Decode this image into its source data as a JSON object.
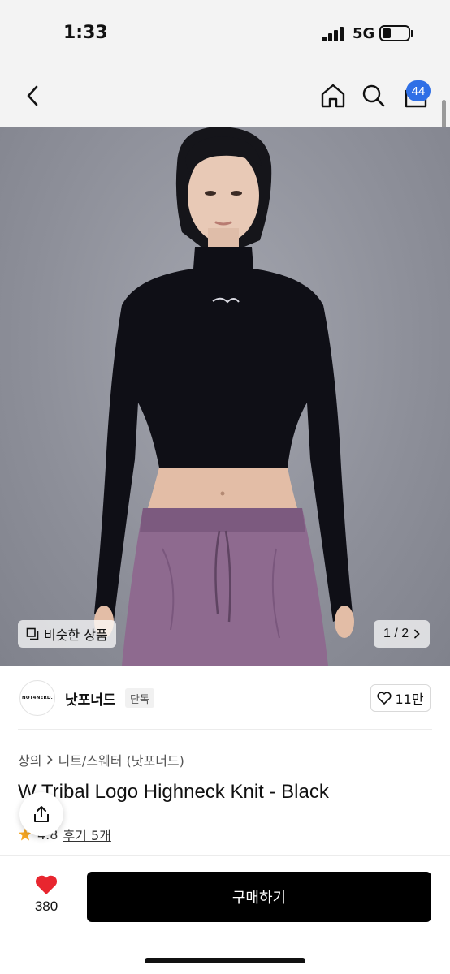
{
  "status_bar": {
    "time": "1:33",
    "network": "5G"
  },
  "nav": {
    "cart_count": "44",
    "icons": [
      "chevron-left-icon",
      "home-icon",
      "search-icon",
      "cart-icon"
    ]
  },
  "hero": {
    "similar_label": "비슷한 상품",
    "page_indicator": "1 / 2"
  },
  "brand": {
    "logo_text": "NOT4NERD.",
    "name": "낫포너드",
    "tag": "단독",
    "likes": "11만"
  },
  "product": {
    "breadcrumb": [
      "상의",
      "니트/스웨터 (낫포너드)"
    ],
    "title": "W Tribal Logo Highneck Knit - Black",
    "rating": "4.8",
    "reviews": "후기 5개"
  },
  "bottom": {
    "wish_count": "380",
    "buy_label": "구매하기"
  },
  "colors": {
    "accent": "#2f6fe6",
    "heart": "#e8262f",
    "star": "#f5a623"
  }
}
